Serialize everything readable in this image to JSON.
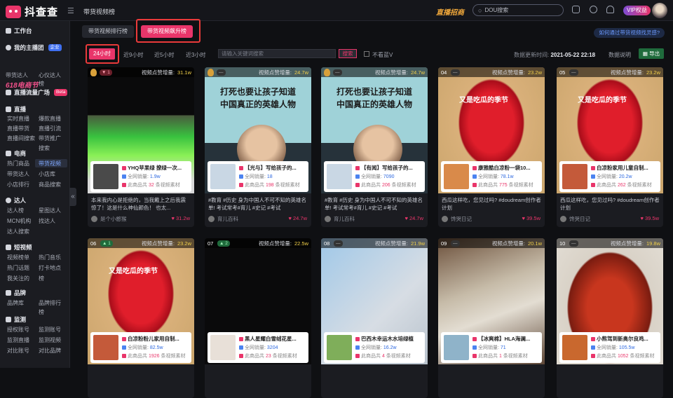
{
  "topbar": {
    "logo": "抖查查",
    "crumb": "带货视频榜",
    "promo": "直播招商",
    "search_placeholder": "DOU搜索",
    "vip": "VIP权益"
  },
  "sidebar": {
    "workbench": "工作台",
    "my_team": "我的主播团",
    "my_team_badge": "企业",
    "row1": [
      "带货达人",
      "心仪达人",
      "榜"
    ],
    "brand618": "618电商节",
    "live_square": "直播流量广场",
    "live_square_badge": "Beta",
    "group_live": "直播",
    "live_items": [
      "实时直播",
      "爆款直播",
      "直播带货",
      "直播引流",
      "直播间搜索",
      "带货推广",
      "搜索"
    ],
    "group_ecom": "电商",
    "ecom_items": [
      "热门商品",
      "带货视频",
      "带货达人",
      "小店库",
      "小店排行",
      "商品搜索"
    ],
    "group_talent": "达人",
    "talent_items": [
      "达人榜",
      "星图达人",
      "MCN机构",
      "找达人",
      "达人搜索"
    ],
    "group_video": "短视频",
    "video_items": [
      "视频榜单",
      "热门音乐",
      "热门话题",
      "打卡地点",
      "我关注的",
      "榜"
    ],
    "group_brand": "品牌",
    "brand_items": [
      "品牌库",
      "品牌排行",
      "榜"
    ],
    "group_monitor": "监测",
    "monitor_items": [
      "授权账号",
      "监测账号",
      "监测直播",
      "监测视频",
      "对比账号",
      "对比品牌"
    ]
  },
  "main": {
    "tab_rank": "带货视频排行榜",
    "tab_hot": "带货视频飙升榜",
    "help": "如何通过带货视频找灵感?",
    "filters": [
      "24小时",
      "近9小时",
      "近5小时",
      "近3小时"
    ],
    "kw_placeholder": "请输入关键词搜索",
    "kw_button": "搜索",
    "chk_label": "不看蓝V",
    "update_label": "数据更新时间:",
    "update_time": "2021-05-22 22:18",
    "explain": "数据说明",
    "export": "导出",
    "metric_label": "视频点赞增量:",
    "sales_label": "全网销量:",
    "count_prefix": "此商品共",
    "count_suffix": "条视频素材"
  },
  "cards": [
    {
      "rank": "",
      "change": "1",
      "dir": "down",
      "delta": "31.1w",
      "cover": "green",
      "poster": "",
      "product": "YHQ苹果绿 撩绿一次...",
      "sales": "1.9w",
      "count": "32",
      "desc": "本来我内心是拒绝的，当我戴上之后我震惊了！这是什么神仙颜色！ 也太...",
      "author": "是个小憨猴",
      "likes": "31.2w",
      "thumb": "#4a4a4a"
    },
    {
      "rank": "",
      "change": "",
      "dir": "flat",
      "delta": "24.7w",
      "cover": "poster",
      "poster": "打死也要让孩子知道|中国真正的英雄人物",
      "product": "【光与】写给孩子的...",
      "sales": "18",
      "count": "198",
      "desc": "#教育 #历史 身为中国人不可不知的英雄名单! 考试常考#育儿 #史记 #考试",
      "author": "育儿百科",
      "likes": "24.7w",
      "thumb": "#c9d7e4"
    },
    {
      "rank": "",
      "change": "",
      "dir": "flat",
      "delta": "24.7w",
      "cover": "poster",
      "poster": "打死也要让孩子知道|中国真正的英雄人物",
      "product": "【有闻】写给孩子的...",
      "sales": "7090",
      "count": "206",
      "desc": "#教育 #历史 身为中国人不可不知的英雄名单! 考试常考#育儿 #史记 #考试",
      "author": "育儿百科",
      "likes": "24.7w",
      "thumb": "#c9d7e4"
    },
    {
      "rank": "04",
      "change": "",
      "dir": "flat",
      "delta": "23.2w",
      "cover": "melon",
      "poster": "又是吃瓜的季节",
      "product": "康雅酷白凉粉一袋10...",
      "sales": "78.1w",
      "count": "775",
      "desc": "西瓜这样吃，您见过吗? #doudream创作者计划",
      "author": "馋哭日记",
      "likes": "39.5w",
      "thumb": "#d98a4a"
    },
    {
      "rank": "05",
      "change": "",
      "dir": "flat",
      "delta": "23.2w",
      "cover": "melon",
      "poster": "又是吃瓜的季节",
      "product": "白凉粉家用儿童自制...",
      "sales": "20.2w",
      "count": "262",
      "desc": "西瓜这样吃，您见过吗? #doudream创作者计划",
      "author": "馋哭日记",
      "likes": "39.5w",
      "thumb": "#c45a3a"
    },
    {
      "rank": "06",
      "change": "1",
      "dir": "up",
      "delta": "23.2w",
      "cover": "melon",
      "poster": "又是吃瓜的季节",
      "product": "白凉粉粉儿家用自制...",
      "sales": "82.5w",
      "count": "1926",
      "desc": "",
      "author": "",
      "likes": "",
      "thumb": "#c45a3a"
    },
    {
      "rank": "07",
      "change": "2",
      "dir": "up",
      "delta": "22.5w",
      "cover": "black",
      "poster": "",
      "product": "黑人星耀白雪绒花星...",
      "sales": "3204",
      "count": "23",
      "desc": "",
      "author": "",
      "likes": "",
      "thumb": "#e8e0d8"
    },
    {
      "rank": "08",
      "change": "",
      "dir": "flat",
      "delta": "21.9w",
      "cover": "cup",
      "poster": "",
      "product": "巴西木幸运木水培绿植",
      "sales": "16.2w",
      "count": "4",
      "desc": "",
      "author": "",
      "likes": "",
      "thumb": "#7fae5a"
    },
    {
      "rank": "09",
      "change": "",
      "dir": "flat",
      "delta": "20.1w",
      "cover": "sketch",
      "poster": "",
      "product": "【冰爽棉】HLA海澜...",
      "sales": "71",
      "count": "1",
      "desc": "",
      "author": "",
      "likes": "",
      "thumb": "#8fb3c9"
    },
    {
      "rank": "10",
      "change": "",
      "dir": "flat",
      "delta": "19.8w",
      "cover": "food",
      "poster": "",
      "product": "小熊驾到新奥尔良鸡...",
      "sales": "105.5w",
      "count": "1052",
      "desc": "",
      "author": "",
      "likes": "",
      "thumb": "#c9682e"
    }
  ],
  "colors": {
    "accent": "#e9356a",
    "link": "#6c9aff",
    "bg": "#0f1013"
  }
}
